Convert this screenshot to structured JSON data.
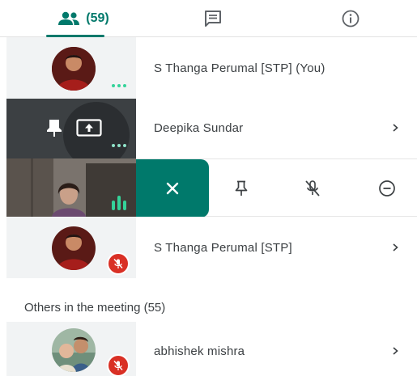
{
  "tabs": {
    "people_count": "(59)",
    "people_icon": "people-icon",
    "chat_icon": "chat-icon",
    "info_icon": "info-icon",
    "accent": "#00796b"
  },
  "participants": [
    {
      "name": "S Thanga Perumal [STP] (You)",
      "status": "more-dots"
    },
    {
      "name": "Deepika Sundar",
      "status": "pinned-presenting"
    },
    {
      "status": "speaking",
      "actions": [
        "close-icon",
        "pin-icon",
        "mute-icon",
        "remove-icon"
      ]
    },
    {
      "name": "S Thanga Perumal [STP]",
      "status": "muted"
    }
  ],
  "others": {
    "title": "Others in the meeting (55)",
    "items": [
      {
        "name": "abhishek mishra",
        "status": "muted"
      }
    ]
  },
  "colors": {
    "muted": "#d93025",
    "tile_light": "#f1f3f4",
    "tile_dark": "#3c4043"
  }
}
